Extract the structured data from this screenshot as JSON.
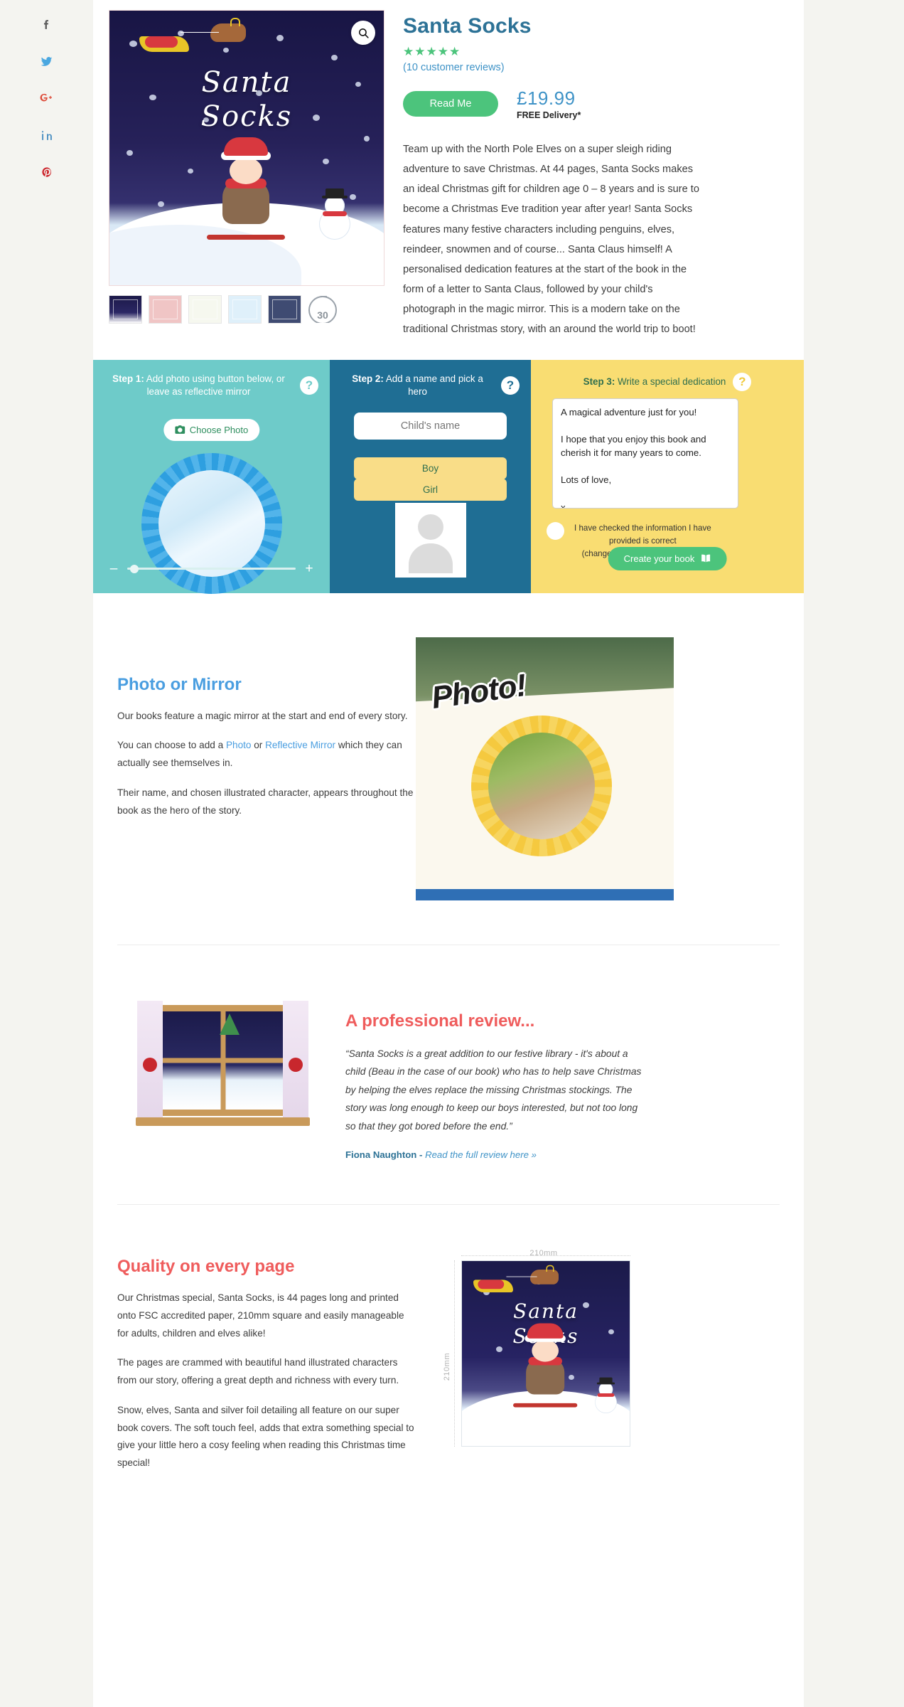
{
  "social": {
    "items": [
      {
        "name": "facebook",
        "glyph": "f",
        "color": "#5b5b5b"
      },
      {
        "name": "twitter",
        "glyph": "t",
        "color": "#4aa7e0"
      },
      {
        "name": "google-plus",
        "glyph": "G+",
        "color": "#dd4b39"
      },
      {
        "name": "linkedin",
        "glyph": "in",
        "color": "#4a8fc2"
      },
      {
        "name": "pinterest",
        "glyph": "P",
        "color": "#cb2027"
      }
    ]
  },
  "product": {
    "title": "Santa Socks",
    "stars": "★★★★★",
    "reviews_link": "(10 customer reviews)",
    "read_me_label": "Read Me",
    "price": "£19.99",
    "delivery": "FREE Delivery*",
    "cover_title_line1": "Santa",
    "cover_title_line2": "Socks",
    "zoom_icon": "search-icon",
    "description": "Team up with the North Pole Elves on a super sleigh riding adventure to save Christmas. At 44 pages, Santa Socks makes an ideal Christmas gift for children age 0 – 8 years and is sure to become a Christmas Eve tradition year after year! Santa Socks features many festive characters including penguins, elves, reindeer, snowmen and of course... Santa Claus himself! A personalised dedication features at the start of the book in the form of a letter to Santa Claus, followed by your child's photograph in the magic mirror. This is a modern take on the traditional Christmas story, with an around the world trip to boot!",
    "thumbnails": [
      "cover-thumb",
      "letter-thumb",
      "mirror-thumb",
      "globe-thumb",
      "night-thumb",
      "stopwatch-thumb"
    ],
    "stopwatch_value": "30"
  },
  "steps": {
    "step1": {
      "label": "Step 1:",
      "text": " Add photo using button below, or leave as reflective mirror",
      "help": "?",
      "choose_photo_label": "Choose Photo",
      "slider_minus": "–",
      "slider_plus": "+"
    },
    "step2": {
      "label": "Step 2:",
      "text": " Add a name and pick a hero",
      "help": "?",
      "name_placeholder": "Child's name",
      "name_value": "",
      "boy_label": "Boy",
      "girl_label": "Girl"
    },
    "step3": {
      "label": "Step 3:",
      "text": " Write a special dedication",
      "help": "?",
      "dedication_value": "A magical adventure just for you!\n\nI hope that you enjoy this book and cherish it for many years to come.\n\nLots of love,\n\nx",
      "confirm_line1": "I have checked the information I have",
      "confirm_line2": "provided is correct",
      "confirm_line3": "(changeable until order is placed)",
      "create_label": "Create your book",
      "create_icon": "book-icon"
    }
  },
  "sections": {
    "photo_mirror": {
      "title": "Photo or Mirror",
      "p1": "Our books feature a magic mirror at the start and end of every story.",
      "p2_a": "You can choose to add a ",
      "p2_photo": "Photo",
      "p2_b": " or ",
      "p2_mirror": "Reflective Mirror",
      "p2_c": " which they can actually see themselves in.",
      "p3": "Their name, and chosen illustrated character, appears throughout the book as the hero of the story.",
      "image_word": "Photo!"
    },
    "review": {
      "title": "A professional review...",
      "quote": "“Santa Socks is a great addition to our festive library - it's about a child (Beau in the case of our book) who has to help save Christmas by helping the elves replace the missing Christmas stockings. The story was long enough to keep our boys interested, but not too long so that they got bored before the end.”",
      "author": "Fiona Naughton - ",
      "link": "Read the full review here »"
    },
    "quality": {
      "title": "Quality on every page",
      "p1": "Our Christmas special, Santa Socks, is 44 pages long and printed onto FSC accredited paper, 210mm square and easily manageable for adults, children and elves alike!",
      "p2": "The pages are crammed with beautiful hand illustrated characters from our story, offering a great depth and richness with every turn.",
      "p3": "Snow, elves, Santa and silver foil detailing all feature on our super book covers. The soft touch feel, adds that extra something special to give your little hero a cosy feeling when reading this Christmas time special!",
      "dim_top": "210mm",
      "dim_side": "210mm"
    }
  },
  "colors": {
    "teal": "#6ecbc9",
    "blue": "#1f6e94",
    "yellow": "#f9dd72",
    "green": "#4cc47c",
    "link_blue": "#3f93c7",
    "red": "#ef5c5c"
  }
}
